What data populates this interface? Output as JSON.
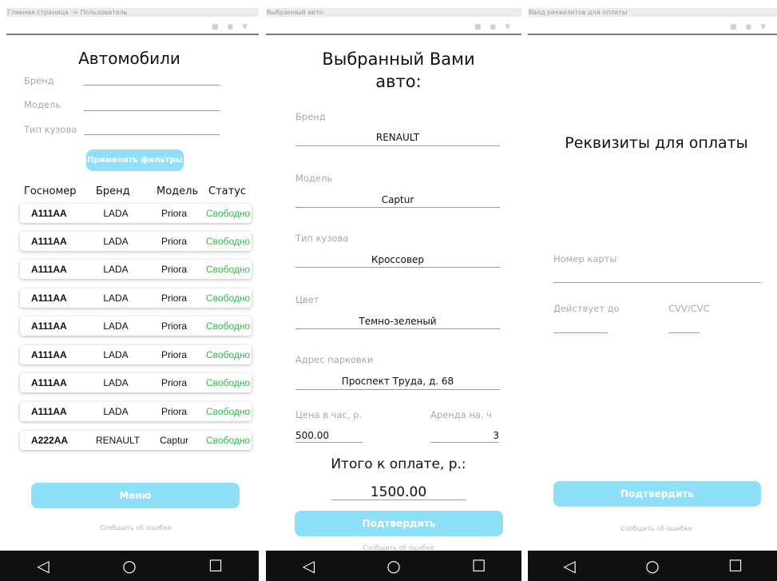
{
  "screen1": {
    "breadcrumb": "Главная страница -> Пользователь",
    "status_icons": "■ ● ▼",
    "title": "Автомобили",
    "filters": [
      {
        "label": "Бренд",
        "value": ""
      },
      {
        "label": "Модель",
        "value": ""
      },
      {
        "label": "Тип кузова",
        "value": ""
      }
    ],
    "apply_button": "Применить фильтры",
    "table_headers": [
      "Госномер",
      "Бренд",
      "Модель",
      "Статус"
    ],
    "rows": [
      {
        "plate": "А111АА",
        "brand": "LADA",
        "model": "Priora",
        "status": "Свободно"
      },
      {
        "plate": "А111АА",
        "brand": "LADA",
        "model": "Priora",
        "status": "Свободно"
      },
      {
        "plate": "А111АА",
        "brand": "LADA",
        "model": "Priora",
        "status": "Свободно"
      },
      {
        "plate": "А111АА",
        "brand": "LADA",
        "model": "Priora",
        "status": "Свободно"
      },
      {
        "plate": "А111АА",
        "brand": "LADA",
        "model": "Priora",
        "status": "Свободно"
      },
      {
        "plate": "А111АА",
        "brand": "LADA",
        "model": "Priora",
        "status": "Свободно"
      },
      {
        "plate": "А111АА",
        "brand": "LADA",
        "model": "Priora",
        "status": "Свободно"
      },
      {
        "plate": "А111АА",
        "brand": "LADA",
        "model": "Priora",
        "status": "Свободно"
      },
      {
        "plate": "А222АА",
        "brand": "RENAULT",
        "model": "Captur",
        "status": "Свободно"
      }
    ],
    "menu_button": "Меню",
    "report_link": "Сообщить об ошибке"
  },
  "screen2": {
    "breadcrumb": "Выбранный авто",
    "status_icons": "■ ● ▼",
    "title_line1": "Выбранный Вами",
    "title_line2": "авто:",
    "fields": [
      {
        "label": "Бренд",
        "value": "RENAULT"
      },
      {
        "label": "Модель",
        "value": "Captur"
      },
      {
        "label": "Тип кузова",
        "value": "Кроссовер"
      },
      {
        "label": "Цвет",
        "value": "Темно-зеленый"
      },
      {
        "label": "Адрес парковки",
        "value": "Проспект Труда, д. 68"
      }
    ],
    "price_label": "Цена в час, р.",
    "price_value": "500.00",
    "rent_label": "Аренда на, ч",
    "rent_value": "3",
    "total_label": "Итого к оплате, р.:",
    "total_value": "1500.00",
    "confirm_button": "Подтвердить",
    "report_link": "Сообщить об ошибке"
  },
  "screen3": {
    "breadcrumb": "Ввод реквизитов для оплаты",
    "status_icons": "■ ● ▼",
    "title": "Реквизиты для оплаты",
    "card_label": "Номер карты",
    "card_value": "",
    "expiry_label": "Действует до",
    "expiry_value": "",
    "cvv_label": "CVV/CVC",
    "cvv_value": "",
    "confirm_button": "Подтвердить",
    "report_link": "Сообщить об ошибке"
  },
  "nav": {
    "back": "◁",
    "home": "○",
    "recents": "☐"
  },
  "colors": {
    "button": "#8ee0f8",
    "status_free": "#27c23f",
    "navbar": "#101010"
  }
}
